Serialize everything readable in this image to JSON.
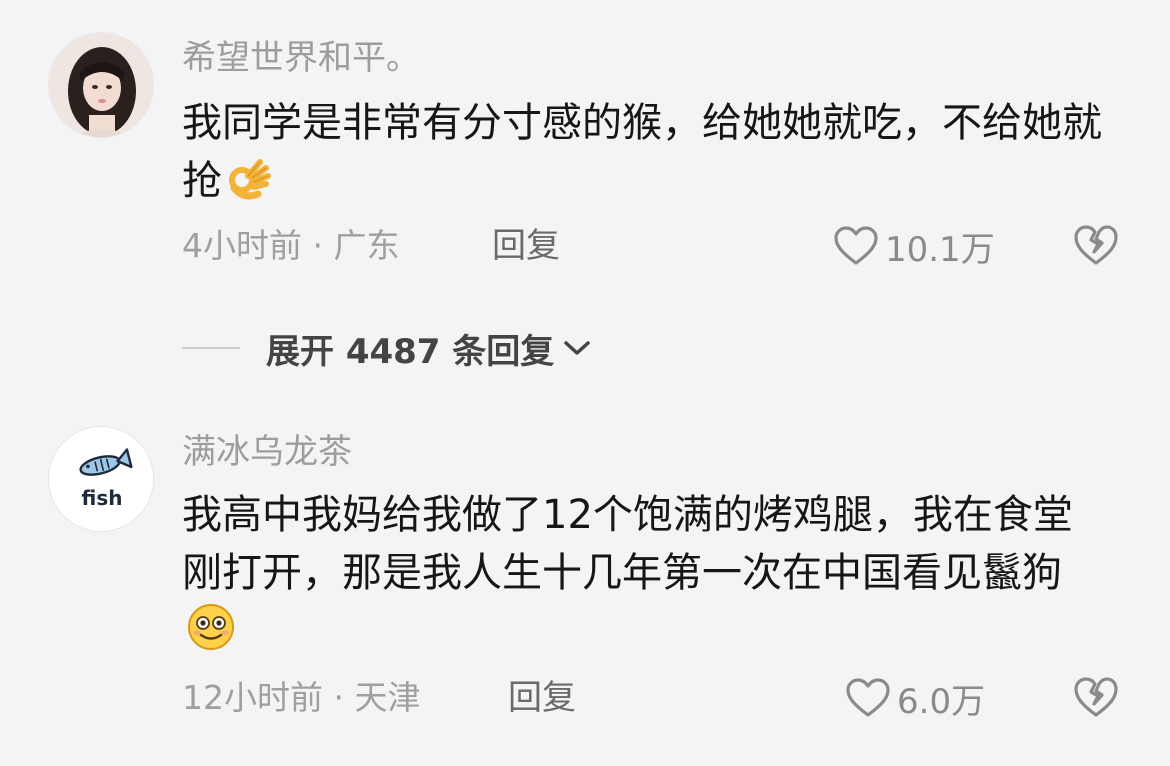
{
  "comments": [
    {
      "username": "希望世界和平。",
      "text": "我同学是非常有分寸感的猴，给她她就吃，不给她就抢",
      "emoji": "ok-hand-emoji",
      "time_location": "4小时前 · 广东",
      "reply_label": "回复",
      "like_count": "10.1万"
    },
    {
      "username": "满冰乌龙茶",
      "avatar_text": "fish",
      "text": "我高中我妈给我做了12个饱满的烤鸡腿，我在食堂刚打开，那是我人生十几年第一次在中国看见鬣狗",
      "emoji": "smile-emoji",
      "time_location": "12小时前 · 天津",
      "reply_label": "回复",
      "like_count": "6.0万"
    }
  ],
  "expand_replies": {
    "label": "展开 4487 条回复"
  },
  "colors": {
    "background": "#f4f4f4",
    "username": "#9d9d9d",
    "text": "#161616",
    "meta": "#9f9f9f",
    "icon": "#8a8a8a"
  }
}
